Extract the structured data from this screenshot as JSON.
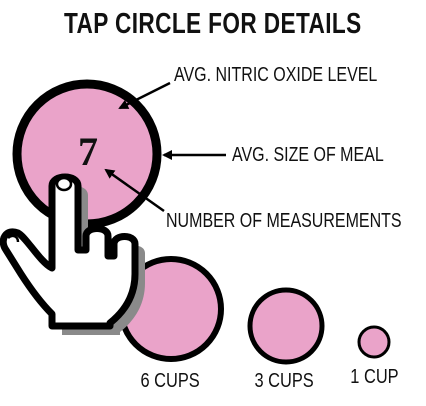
{
  "title": "TAP CIRCLE FOR DETAILS",
  "example": {
    "count": "7",
    "labels": {
      "nitric_oxide": "AVG. NITRIC OXIDE LEVEL",
      "meal_size": "AVG. SIZE OF MEAL",
      "measurements": "NUMBER OF MEASUREMENTS"
    }
  },
  "legend": [
    {
      "label": "6 CUPS",
      "cups": 6
    },
    {
      "label": "3 CUPS",
      "cups": 3
    },
    {
      "label": "1 CUP",
      "cups": 1
    }
  ],
  "colors": {
    "circle_fill": "#eaa3c9",
    "outline": "#000000",
    "hand_shadow": "#8a8a8a"
  },
  "icons": [
    "tap-hand-icon"
  ]
}
